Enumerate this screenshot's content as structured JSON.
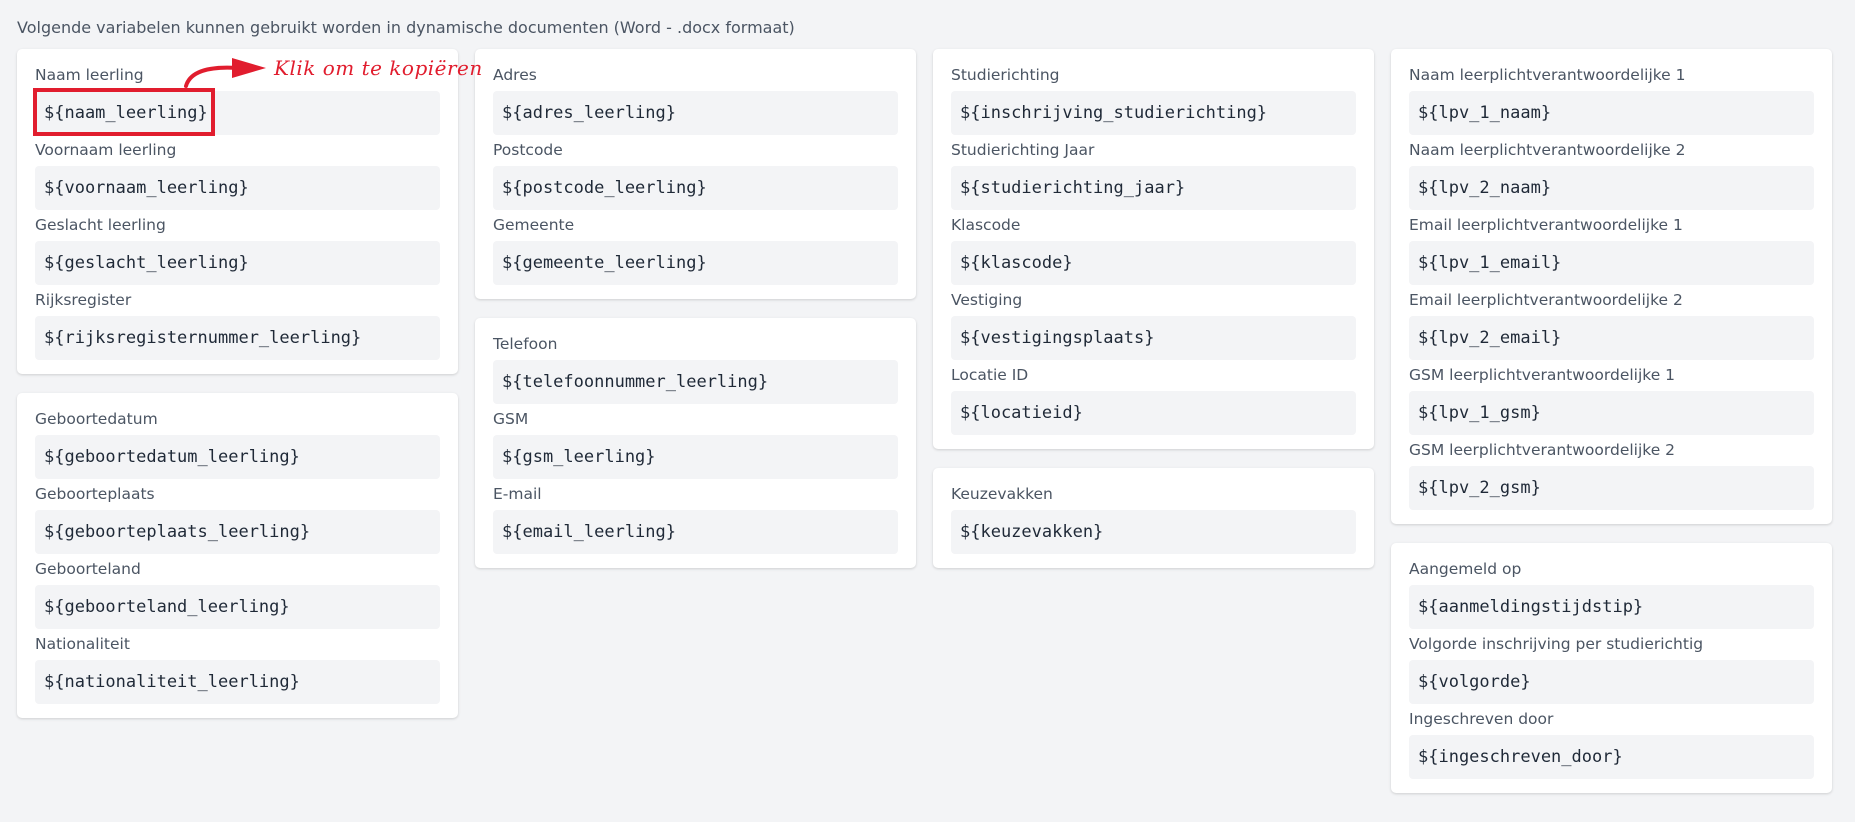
{
  "intro_text": "Volgende variabelen kunnen gebruikt worden in dynamische documenten (Word - .docx formaat)",
  "annotation": {
    "text": "Klik om te kopiëren",
    "color": "#e11d2e"
  },
  "columns": [
    {
      "cards": [
        {
          "fields": [
            {
              "label": "Naam leerling",
              "value": "${naam_leerling}"
            },
            {
              "label": "Voornaam leerling",
              "value": "${voornaam_leerling}"
            },
            {
              "label": "Geslacht leerling",
              "value": "${geslacht_leerling}"
            },
            {
              "label": "Rijksregister",
              "value": "${rijksregisternummer_leerling}"
            }
          ]
        },
        {
          "fields": [
            {
              "label": "Geboortedatum",
              "value": "${geboortedatum_leerling}"
            },
            {
              "label": "Geboorteplaats",
              "value": "${geboorteplaats_leerling}"
            },
            {
              "label": "Geboorteland",
              "value": "${geboorteland_leerling}"
            },
            {
              "label": "Nationaliteit",
              "value": "${nationaliteit_leerling}"
            }
          ]
        }
      ]
    },
    {
      "cards": [
        {
          "fields": [
            {
              "label": "Adres",
              "value": "${adres_leerling}"
            },
            {
              "label": "Postcode",
              "value": "${postcode_leerling}"
            },
            {
              "label": "Gemeente",
              "value": "${gemeente_leerling}"
            }
          ]
        },
        {
          "fields": [
            {
              "label": "Telefoon",
              "value": "${telefoonnummer_leerling}"
            },
            {
              "label": "GSM",
              "value": "${gsm_leerling}"
            },
            {
              "label": "E-mail",
              "value": "${email_leerling}"
            }
          ]
        }
      ]
    },
    {
      "cards": [
        {
          "fields": [
            {
              "label": "Studierichting",
              "value": "${inschrijving_studierichting}"
            },
            {
              "label": "Studierichting Jaar",
              "value": "${studierichting_jaar}"
            },
            {
              "label": "Klascode",
              "value": "${klascode}"
            },
            {
              "label": "Vestiging",
              "value": "${vestigingsplaats}"
            },
            {
              "label": "Locatie ID",
              "value": "${locatieid}"
            }
          ]
        },
        {
          "fields": [
            {
              "label": "Keuzevakken",
              "value": "${keuzevakken}"
            }
          ]
        }
      ]
    },
    {
      "cards": [
        {
          "fields": [
            {
              "label": "Naam leerplichtverantwoordelijke 1",
              "value": "${lpv_1_naam}"
            },
            {
              "label": "Naam leerplichtverantwoordelijke 2",
              "value": "${lpv_2_naam}"
            },
            {
              "label": "Email leerplichtverantwoordelijke 1",
              "value": "${lpv_1_email}"
            },
            {
              "label": "Email leerplichtverantwoordelijke 2",
              "value": "${lpv_2_email}"
            },
            {
              "label": "GSM leerplichtverantwoordelijke 1",
              "value": "${lpv_1_gsm}"
            },
            {
              "label": "GSM leerplichtverantwoordelijke 2",
              "value": "${lpv_2_gsm}"
            }
          ]
        },
        {
          "fields": [
            {
              "label": "Aangemeld op",
              "value": "${aanmeldingstijdstip}"
            },
            {
              "label": "Volgorde inschrijving per studierichtig",
              "value": "${volgorde}"
            },
            {
              "label": "Ingeschreven door",
              "value": "${ingeschreven_door}"
            }
          ]
        }
      ]
    }
  ]
}
